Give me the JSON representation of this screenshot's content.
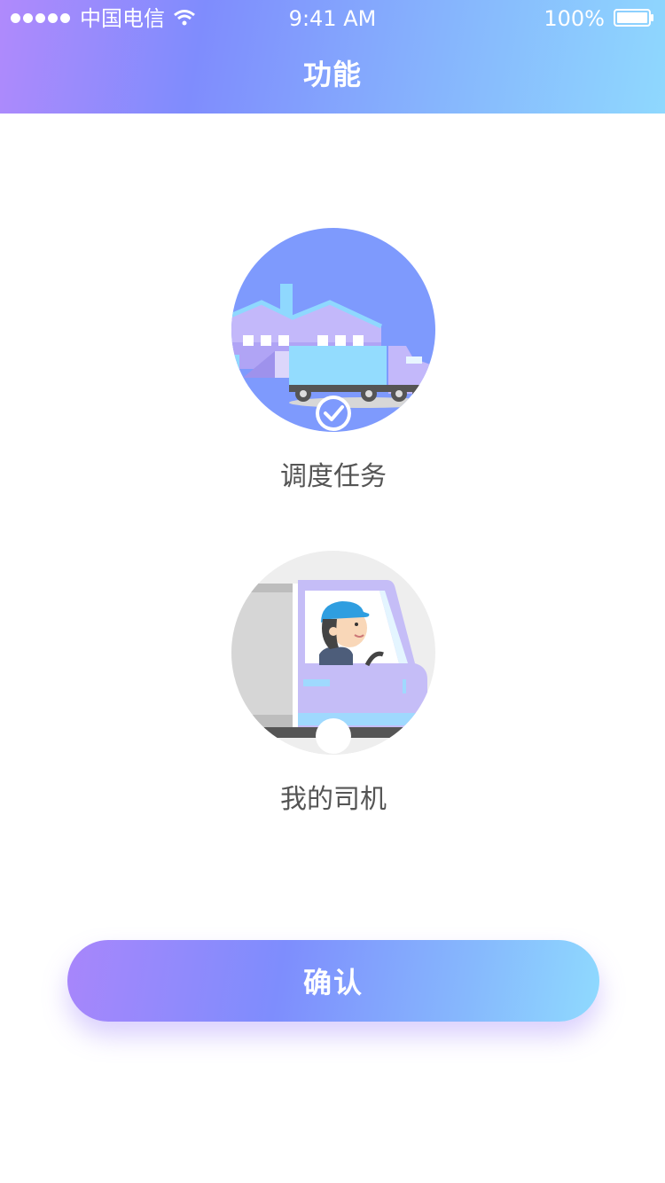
{
  "status_bar": {
    "carrier": "中国电信",
    "time": "9:41 AM",
    "battery": "100%"
  },
  "nav": {
    "title": "功能"
  },
  "options": [
    {
      "label": "调度任务",
      "icon": "dispatch-task-illustration",
      "selected": true
    },
    {
      "label": "我的司机",
      "icon": "my-driver-illustration",
      "selected": false
    }
  ],
  "confirm": {
    "label": "确认"
  },
  "colors": {
    "gradient_start": "#a886fb",
    "gradient_mid": "#7e8dfd",
    "gradient_end": "#8fdafe",
    "label_text": "#555555"
  }
}
